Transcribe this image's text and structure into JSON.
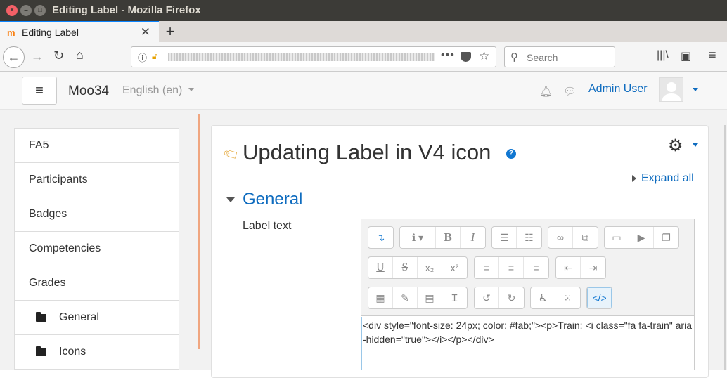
{
  "window": {
    "title": "Editing Label - Mozilla Firefox"
  },
  "tab": {
    "title": "Editing Label",
    "favicon": "m",
    "close": "✕",
    "new_tab": "+"
  },
  "nav": {
    "search_placeholder": "Search",
    "url_more": "•••"
  },
  "header": {
    "site_name": "Moo34",
    "language": "English (en)",
    "user_name": "Admin User"
  },
  "drawer": {
    "items": [
      {
        "label": "FA5"
      },
      {
        "label": "Participants"
      },
      {
        "label": "Badges"
      },
      {
        "label": "Competencies"
      },
      {
        "label": "Grades"
      },
      {
        "label": "General"
      },
      {
        "label": "Icons"
      }
    ]
  },
  "main": {
    "page_title": "Updating Label in V4 icon",
    "expand_all": "Expand all",
    "section_title": "General",
    "field_label": "Label text",
    "editor_content": "<div style=\"font-size: 24px; color: #fab;\"><p>Train: <i class=\"fa fa-train\" aria-hidden=\"true\"></i></p></div>"
  },
  "colors": {
    "link": "#0f6cbf",
    "accent": "#f98012",
    "help": "#1177d1"
  },
  "icons": [
    "back-icon",
    "forward-icon",
    "reload-icon",
    "home-icon",
    "info-icon",
    "lock-icon",
    "pocket-icon",
    "star-icon",
    "search-icon",
    "library-icon",
    "sidebar-icon",
    "menu-icon",
    "bell-icon",
    "message-icon",
    "gear-icon",
    "help-icon",
    "folder-icon"
  ]
}
